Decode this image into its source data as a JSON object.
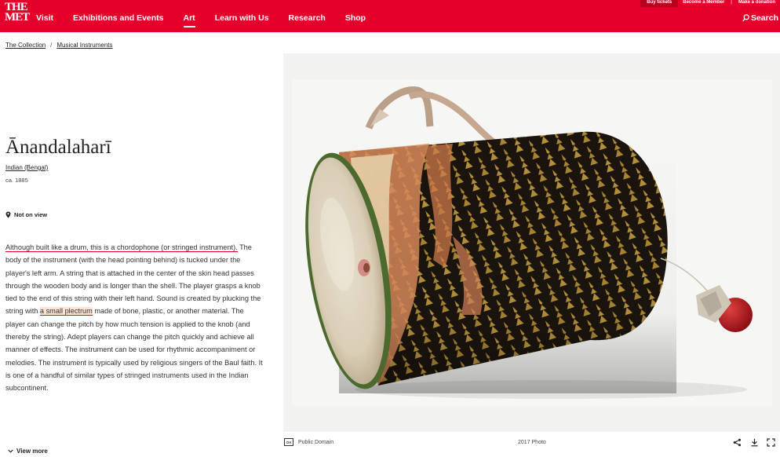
{
  "header": {
    "logo_line1": "THE",
    "logo_line2": "MET",
    "nav": [
      "Visit",
      "Exhibitions and Events",
      "Art",
      "Learn with Us",
      "Research",
      "Shop"
    ],
    "active_nav": "Art",
    "top_links": [
      "Buy tickets",
      "Become a Member",
      "|",
      "Make a donation"
    ],
    "search_label": "Search",
    "brand_color": "#e4002b"
  },
  "breadcrumb": [
    "The Collection",
    "Musical Instruments"
  ],
  "object": {
    "title": "Ānandalaharī",
    "culture": "Indian (Bengal)",
    "date": "ca. 1885",
    "on_view": "Not on view",
    "description": {
      "highlight1": "Although built like a drum, this is a chordophone (or stringed instrument).",
      "part2": " The body of the instrument (with the head pointing behind) is tucked under the player's left arm. A string that is attached in the center of the skin head passes through the wooden body and is longer than the shell. The player grasps a knob tied to the end of this string with their left hand. Sound is created by plucking the string with ",
      "highlight2": "a small plectrum",
      "part3": " made of bone, plastic, or another material. The player can change the pitch by how much tension is applied to the knob (and thereby the string). Adept players can change the pitch quickly and achieve all manner of effects. The instrument can be used for rhythmic accompaniment or melodies. The instrument is typically used by religious singers of the Baul faith. It is one of a handful of similar types of stringed instruments used in the Indian subcontinent."
    },
    "view_more": "View more"
  },
  "image_footer": {
    "oa_badge": "OA",
    "license": "Public Domain",
    "photo_date": "2017 Photo"
  }
}
